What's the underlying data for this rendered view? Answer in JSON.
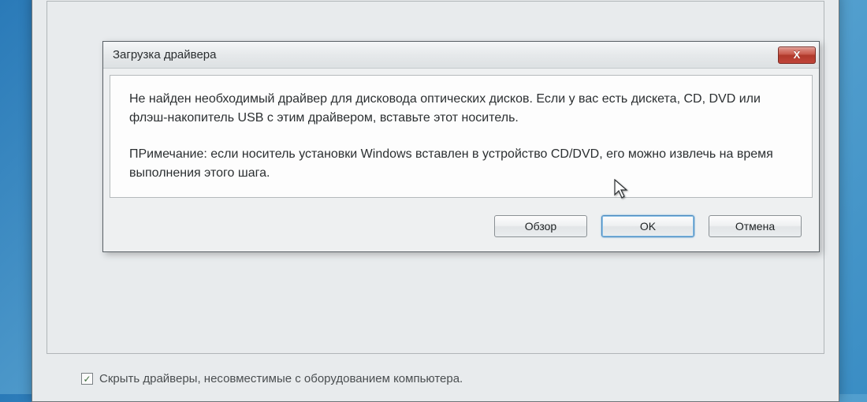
{
  "dialog": {
    "title": "Загрузка драйвера",
    "close_glyph": "X",
    "message": "Не найден необходимый драйвер для дисковода оптических дисков. Если у вас есть дискета, CD, DVD или флэш-накопитель USB с этим драйвером, вставьте этот носитель.",
    "note": "ПРимечание: если носитель установки Windows вставлен в устройство CD/DVD, его можно извлечь на время выполнения этого шага.",
    "buttons": {
      "browse": "Обзор",
      "ok": "OK",
      "cancel": "Отмена"
    }
  },
  "parent": {
    "checkbox_label": "Скрыть драйверы, несовместимые с оборудованием компьютера.",
    "checkbox_checked": "✓"
  }
}
